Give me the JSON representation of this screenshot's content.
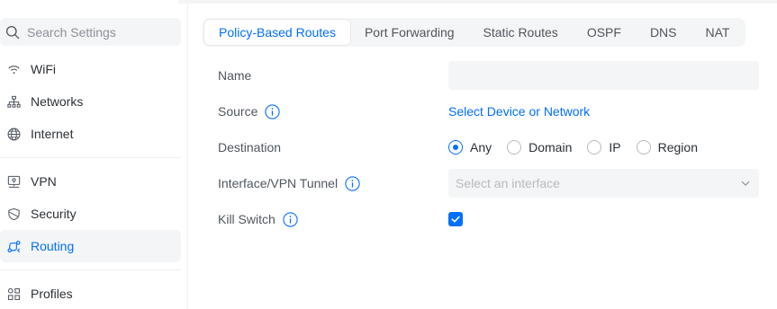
{
  "sidebar": {
    "search_placeholder": "Search Settings",
    "items": [
      {
        "label": "WiFi",
        "icon": "wifi-icon"
      },
      {
        "label": "Networks",
        "icon": "networks-icon"
      },
      {
        "label": "Internet",
        "icon": "globe-icon"
      },
      {
        "label": "VPN",
        "icon": "vpn-icon"
      },
      {
        "label": "Security",
        "icon": "shield-icon"
      },
      {
        "label": "Routing",
        "icon": "routing-icon",
        "active": true
      },
      {
        "label": "Profiles",
        "icon": "profiles-icon"
      }
    ]
  },
  "tabs": [
    {
      "label": "Policy-Based Routes",
      "active": true
    },
    {
      "label": "Port Forwarding"
    },
    {
      "label": "Static Routes"
    },
    {
      "label": "OSPF"
    },
    {
      "label": "DNS"
    },
    {
      "label": "NAT"
    }
  ],
  "form": {
    "name": {
      "label": "Name",
      "value": ""
    },
    "source": {
      "label": "Source",
      "action": "Select Device or Network"
    },
    "destination": {
      "label": "Destination",
      "options": [
        "Any",
        "Domain",
        "IP",
        "Region"
      ],
      "selected": "Any"
    },
    "interface": {
      "label": "Interface/VPN Tunnel",
      "placeholder": "Select an interface"
    },
    "kill_switch": {
      "label": "Kill Switch",
      "checked": true
    }
  },
  "colors": {
    "accent": "#006fff",
    "text": "#50565e",
    "field_bg": "#f4f5f6"
  }
}
